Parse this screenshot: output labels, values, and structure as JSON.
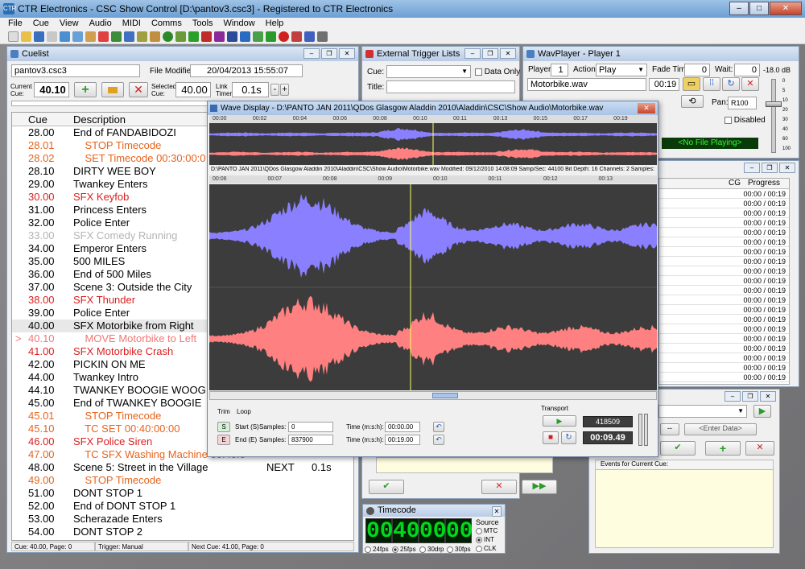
{
  "app": {
    "title": "CTR Electronics - CSC Show Control [D:\\pantov3.csc3] - Registered to CTR Electronics",
    "logo": "CTR"
  },
  "menu": [
    "File",
    "Cue",
    "View",
    "Audio",
    "MIDI",
    "Comms",
    "Tools",
    "Window",
    "Help"
  ],
  "cuelist": {
    "title": "Cuelist",
    "filename": "pantov3.csc3",
    "file_modified_label": "File Modified:",
    "file_modified": "20/04/2013 15:55:07",
    "current_cue_label": "Current Cue:",
    "current_cue": "40.10",
    "selected_cue_label": "Selected Cue:",
    "selected_cue": "40.00",
    "link_timer_label": "Link Timer:",
    "link_timer": "0.1s",
    "minus": "-",
    "plus": "+",
    "col_cue": "Cue",
    "col_description": "Description",
    "rows": [
      {
        "cue": "28.00",
        "desc": "End of FANDABIDOZI",
        "color": "#000000"
      },
      {
        "cue": "28.01",
        "desc": "    STOP Timecode",
        "color": "#e5641e"
      },
      {
        "cue": "28.02",
        "desc": "    SET Timecode 00:30:00:0",
        "color": "#e5641e"
      },
      {
        "cue": "28.10",
        "desc": "DIRTY WEE BOY",
        "color": "#000000"
      },
      {
        "cue": "29.00",
        "desc": "Twankey Enters",
        "color": "#000000"
      },
      {
        "cue": "30.00",
        "desc": "SFX Keyfob",
        "color": "#dc1e1e"
      },
      {
        "cue": "31.00",
        "desc": "Princess Enters",
        "color": "#000000"
      },
      {
        "cue": "32.00",
        "desc": "Police Enter",
        "color": "#000000"
      },
      {
        "cue": "33.00",
        "desc": "SFX Comedy Running",
        "color": "#b4b4b4"
      },
      {
        "cue": "34.00",
        "desc": "Emperor Enters",
        "color": "#000000"
      },
      {
        "cue": "35.00",
        "desc": "500 MILES",
        "color": "#000000"
      },
      {
        "cue": "36.00",
        "desc": "End of 500 Miles",
        "color": "#000000"
      },
      {
        "cue": "37.00",
        "desc": "Scene 3: Outside the City",
        "color": "#000000"
      },
      {
        "cue": "38.00",
        "desc": "SFX Thunder",
        "color": "#dc1e1e"
      },
      {
        "cue": "39.00",
        "desc": "Police Enter",
        "color": "#000000"
      },
      {
        "cue": "40.00",
        "desc": "SFX Motorbike from Right",
        "color": "#000000"
      },
      {
        "cue": "40.10",
        "desc": "    MOVE Motorbike to Left",
        "color": "#f07878",
        "pointer": ">"
      },
      {
        "cue": "41.00",
        "desc": "SFX Motorbike Crash",
        "color": "#dc1e1e"
      },
      {
        "cue": "42.00",
        "desc": "PICKIN ON ME",
        "color": "#000000"
      },
      {
        "cue": "44.00",
        "desc": "Twankey Intro",
        "color": "#000000"
      },
      {
        "cue": "44.10",
        "desc": "TWANKEY BOOGIE WOOG",
        "color": "#000000"
      },
      {
        "cue": "45.00",
        "desc": "End of TWANKEY BOOGIE",
        "color": "#000000"
      },
      {
        "cue": "45.01",
        "desc": "    STOP Timecode",
        "color": "#e5641e"
      },
      {
        "cue": "45.10",
        "desc": "    TC SET 00:40:00:00",
        "color": "#e5641e"
      },
      {
        "cue": "46.00",
        "desc": "SFX Police Siren",
        "color": "#dc1e1e"
      },
      {
        "cue": "47.00",
        "desc": "    TC SFX Washing Machine 00:40:0",
        "color": "#e5641e"
      },
      {
        "cue": "48.00",
        "desc": "Scene 5: Street in the Village",
        "color": "#000000",
        "next": "NEXT",
        "wait": "0.1s"
      },
      {
        "cue": "49.00",
        "desc": "    STOP Timecode",
        "color": "#e5641e"
      },
      {
        "cue": "51.00",
        "desc": "DONT STOP 1",
        "color": "#000000"
      },
      {
        "cue": "52.00",
        "desc": "End of DONT STOP 1",
        "color": "#000000"
      },
      {
        "cue": "53.00",
        "desc": "Scherazade Enters",
        "color": "#000000"
      },
      {
        "cue": "54.00",
        "desc": "DONT STOP 2",
        "color": "#000000"
      }
    ],
    "status_cue": "Cue: 40.00, Page: 0",
    "status_trigger": "Trigger: Manual",
    "status_next": "Next Cue: 41.00, Page: 0"
  },
  "external": {
    "title": "External Trigger Lists",
    "cue_label": "Cue:",
    "data_only": "Data Only",
    "title_label": "Title:"
  },
  "wavplayer": {
    "title": "WavPlayer - Player 1",
    "player_label": "Player:",
    "player": "1",
    "action_label": "Action:",
    "action": "Play",
    "fade_label": "Fade Time:",
    "fade": "0",
    "wait_label": "Wait:",
    "wait": "0",
    "db": "-18.0 dB",
    "file": "Motorbike.wav",
    "time": "00:19",
    "pan_label": "Pan:",
    "pan": "R100",
    "disabled": "Disabled",
    "status": "<No File Playing>",
    "scale": [
      "0",
      "5",
      "10",
      "20",
      "30",
      "40",
      "60",
      "100"
    ]
  },
  "progress": {
    "cg_label": "CG",
    "progress_label": "Progress",
    "rows": [
      "00:00 / 00:19",
      "00:00 / 00:19",
      "00:00 / 00:19",
      "00:00 / 00:19",
      "00:00 / 00:19",
      "00:00 / 00:19",
      "00:00 / 00:19",
      "00:00 / 00:19",
      "00:00 / 00:19",
      "00:00 / 00:19",
      "00:00 / 00:19",
      "00:00 / 00:19",
      "00:00 / 00:19",
      "00:00 / 00:19",
      "00:00 / 00:19",
      "00:00 / 00:19",
      "00:00 / 00:19",
      "00:00 / 00:19",
      "00:00 / 00:19",
      "00:00 / 00:19"
    ]
  },
  "events": {
    "enter_data": "<Enter Data>",
    "dash": "--",
    "label": "Events for Current Cue:"
  },
  "wave": {
    "title": "Wave Display - D:\\PANTO JAN 2011\\QDos Glasgow Aladdin 2010\\Aladdin\\CSC\\Show Audio\\Motorbike.wav",
    "overview_ticks": [
      "00:00",
      "00:02",
      "00:04",
      "00:06",
      "00:08",
      "00:10",
      "00:11",
      "00:13",
      "00:15",
      "00:17",
      "00:19"
    ],
    "info": "D:\\PANTO JAN 2011\\QDos Glasgow Aladdin 2010\\Aladdin\\CSC\\Show Audio\\Motorbike.wav    Modified: 09/12/2010 14:08:09    Samp/Sec: 44100    Bit Depth: 16    Channels: 2    Samples:",
    "detail_ticks": [
      "00:06",
      "00:07",
      "00:08",
      "00:09",
      "00:10",
      "00:11",
      "00:12",
      "00:13"
    ],
    "tab_trim": "Trim",
    "tab_loop": "Loop",
    "start_btn": "S",
    "start_label": "Start (S)",
    "samples_label": "Samples:",
    "start_samples": "0",
    "time_label": "Time (m:s:h):",
    "start_time": "00:00.00",
    "end_btn": "E",
    "end_label": "End  (E)",
    "end_samples": "837900",
    "end_time": "00:19.00",
    "transport_label": "Transport",
    "sample_pos": "418509",
    "time_pos": "00:09.49"
  },
  "timecode": {
    "title": "Timecode",
    "digits": [
      "00",
      "40",
      "00",
      "00"
    ],
    "source_label": "Source",
    "sources": [
      "MTC",
      "INT",
      "CLK"
    ],
    "fps": [
      "24fps",
      "25fps",
      "30drp",
      "30fps"
    ]
  },
  "colors": {
    "blue_wave": "#8a80ff",
    "red_wave": "#ff8080",
    "cursor": "#ffff64"
  }
}
